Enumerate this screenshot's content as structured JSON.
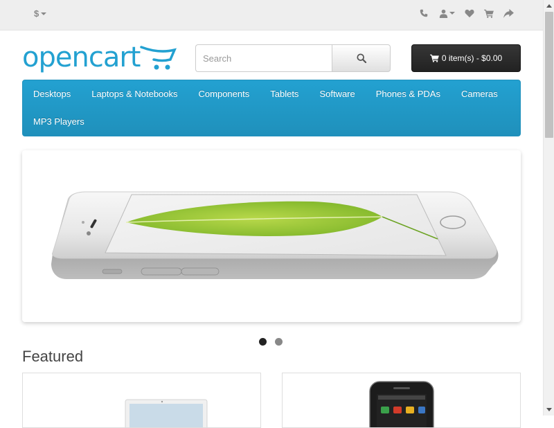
{
  "topbar": {
    "currency": "$",
    "icons": [
      "phone-icon",
      "user-icon",
      "heart-icon",
      "cart-icon",
      "share-icon"
    ]
  },
  "header": {
    "logo_text": "opencart",
    "search_placeholder": "Search",
    "cart_label": "0 item(s) - $0.00"
  },
  "nav": {
    "row1": [
      "Desktops",
      "Laptops & Notebooks",
      "Components",
      "Tablets",
      "Software",
      "Phones & PDAs",
      "Cameras"
    ],
    "row2": [
      "MP3 Players"
    ]
  },
  "slideshow": {
    "active_index": 0,
    "count": 2
  },
  "featured": {
    "title": "Featured"
  },
  "colors": {
    "brand": "#23a1d1",
    "nav_bg": "#229ac8",
    "cart_bg": "#303030",
    "dot_active": "#222222",
    "dot_inactive": "#888888"
  }
}
